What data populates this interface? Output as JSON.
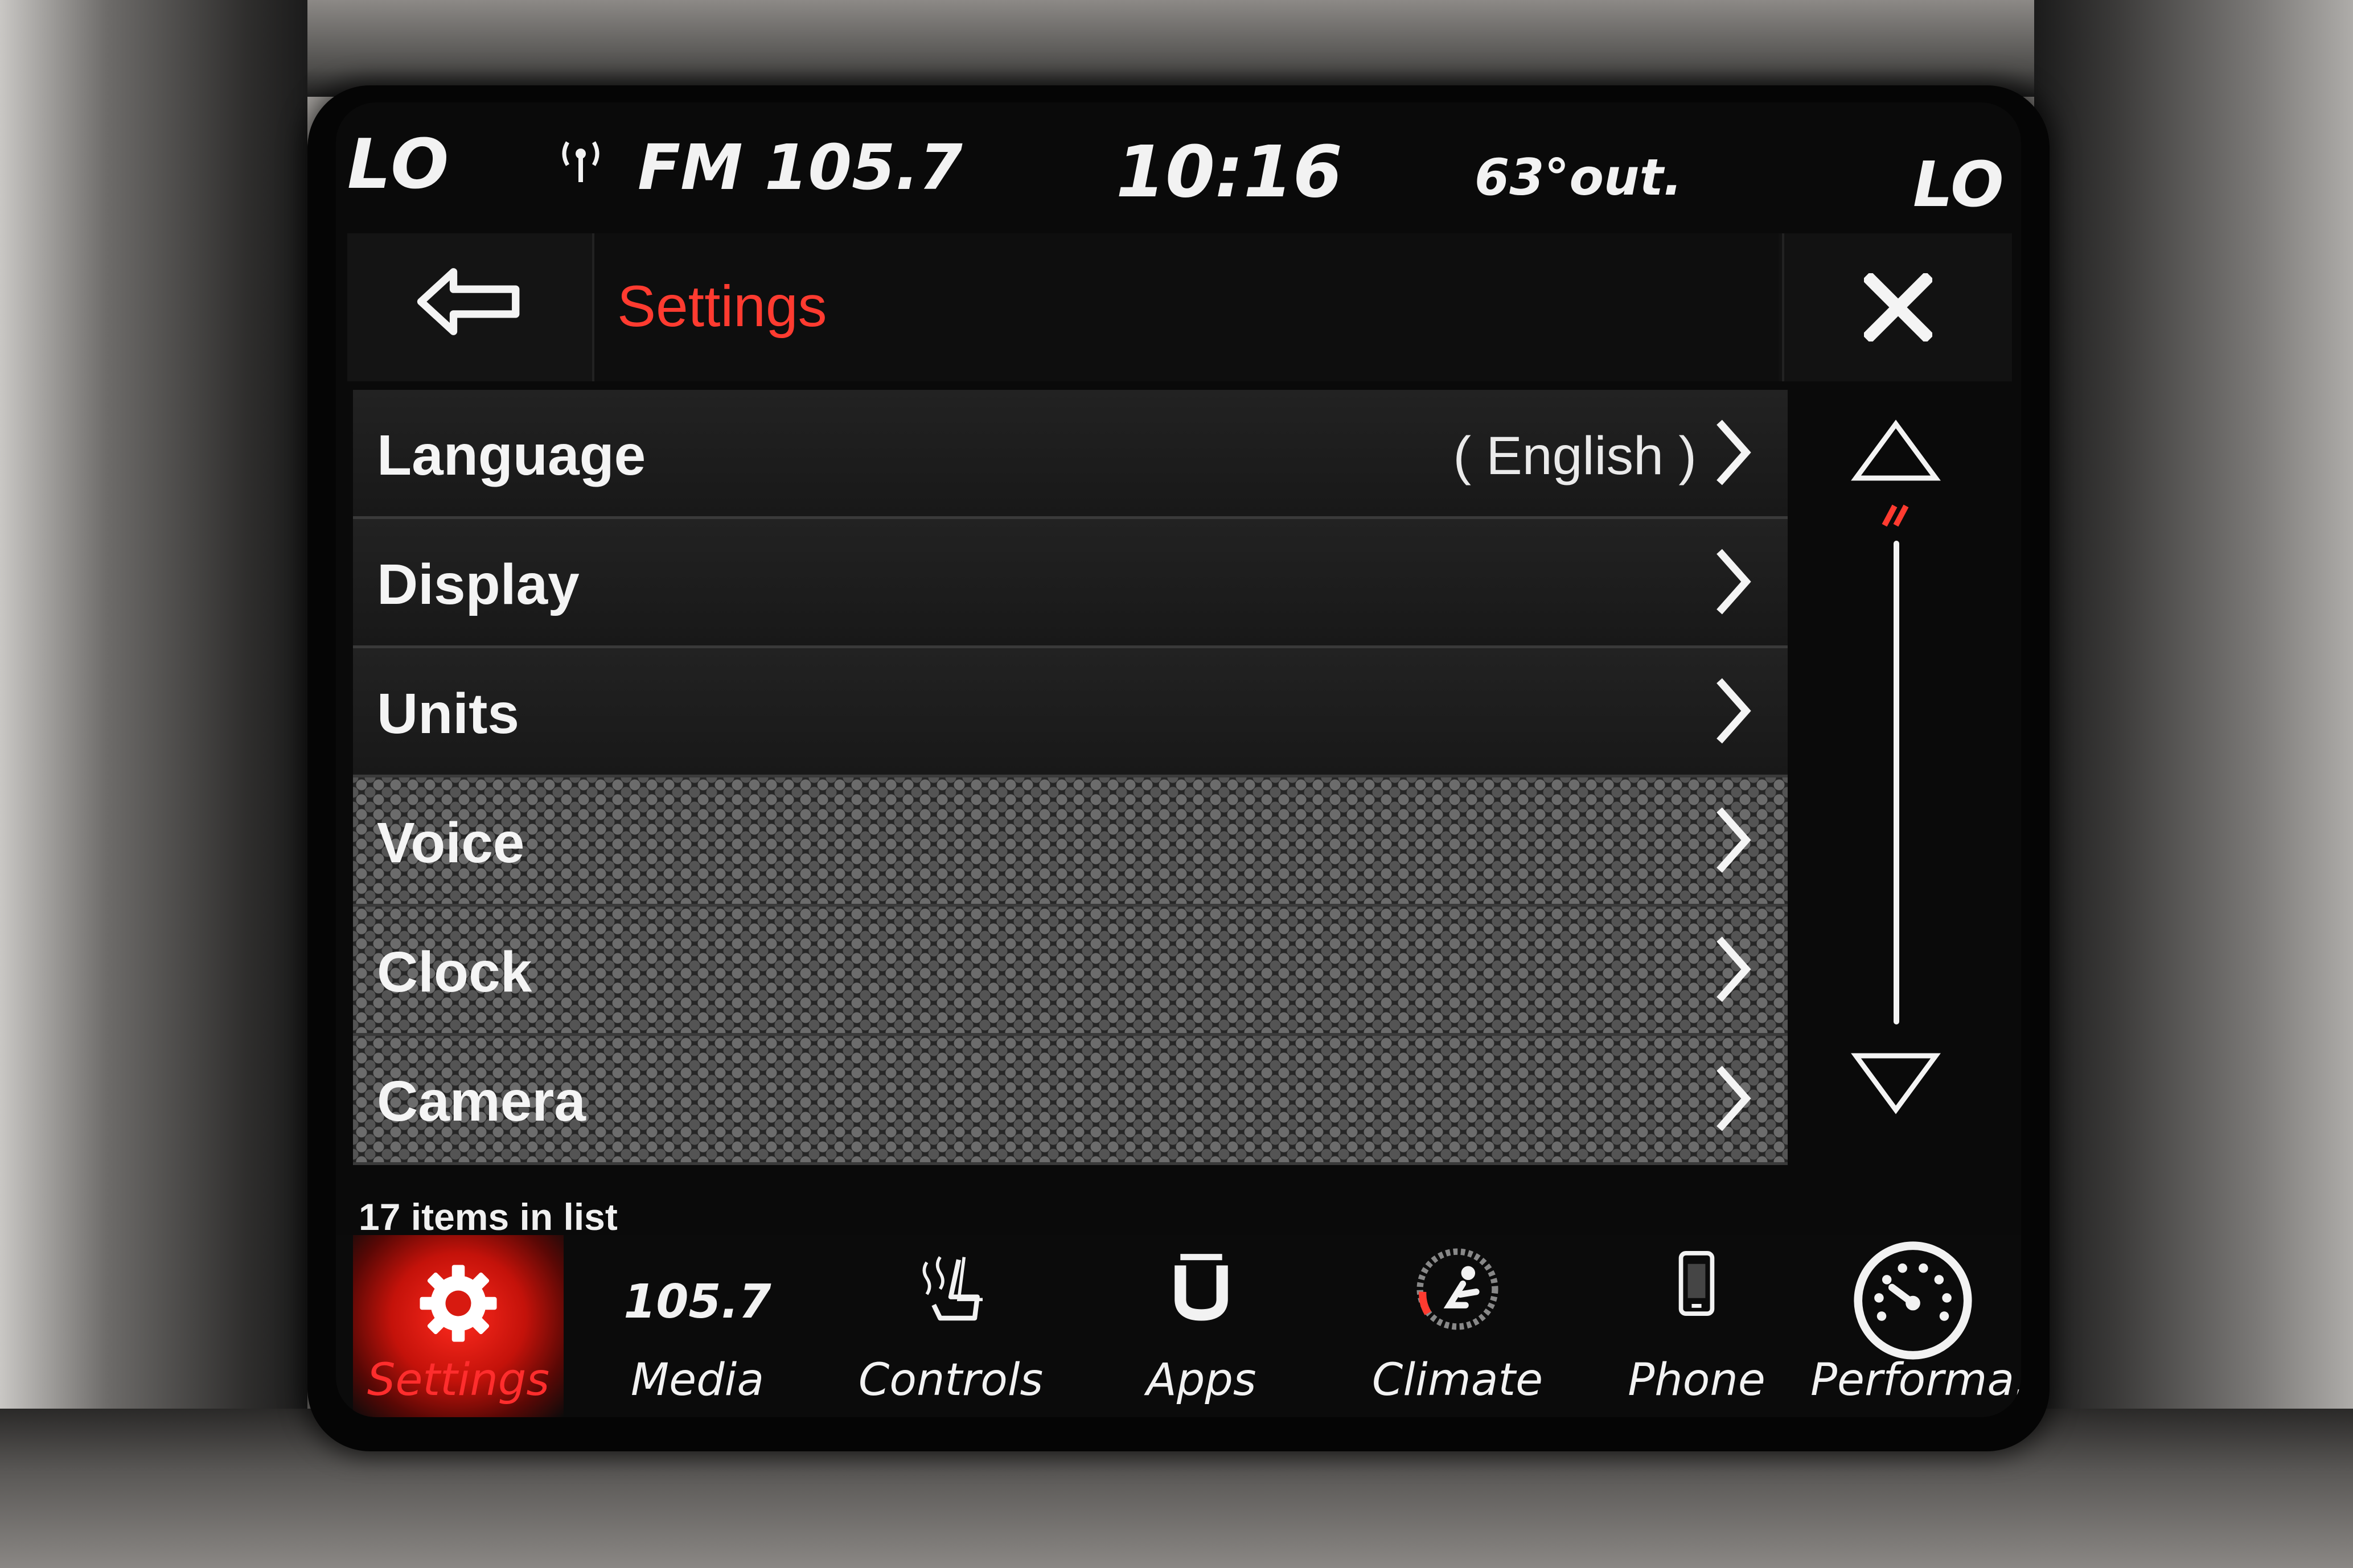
{
  "status_bar": {
    "left_temp": "LO",
    "radio": "FM 105.7",
    "time": "10:16",
    "outside_temp": "63°out.",
    "right_temp": "LO"
  },
  "header": {
    "title": "Settings"
  },
  "list": {
    "items": [
      {
        "label": "Language",
        "value": "( English )"
      },
      {
        "label": "Display",
        "value": ""
      },
      {
        "label": "Units",
        "value": ""
      },
      {
        "label": "Voice",
        "value": ""
      },
      {
        "label": "Clock",
        "value": ""
      },
      {
        "label": "Camera",
        "value": ""
      }
    ],
    "count_text": "17 items in list"
  },
  "nav": {
    "items": [
      {
        "label": "Settings",
        "icon": "gear-icon",
        "active": true
      },
      {
        "label": "Media",
        "icon": "",
        "freq": "105.7"
      },
      {
        "label": "Controls",
        "icon": "seat-heat-icon"
      },
      {
        "label": "Apps",
        "icon": "uconnect-icon"
      },
      {
        "label": "Climate",
        "icon": "climate-icon"
      },
      {
        "label": "Phone",
        "icon": "phone-icon"
      },
      {
        "label": "Performa.",
        "icon": "gauge-icon"
      }
    ]
  },
  "colors": {
    "accent": "#ff3b30",
    "active_nav": "#e0150c",
    "text": "#f2f2f2",
    "background": "#0a0a0a"
  }
}
